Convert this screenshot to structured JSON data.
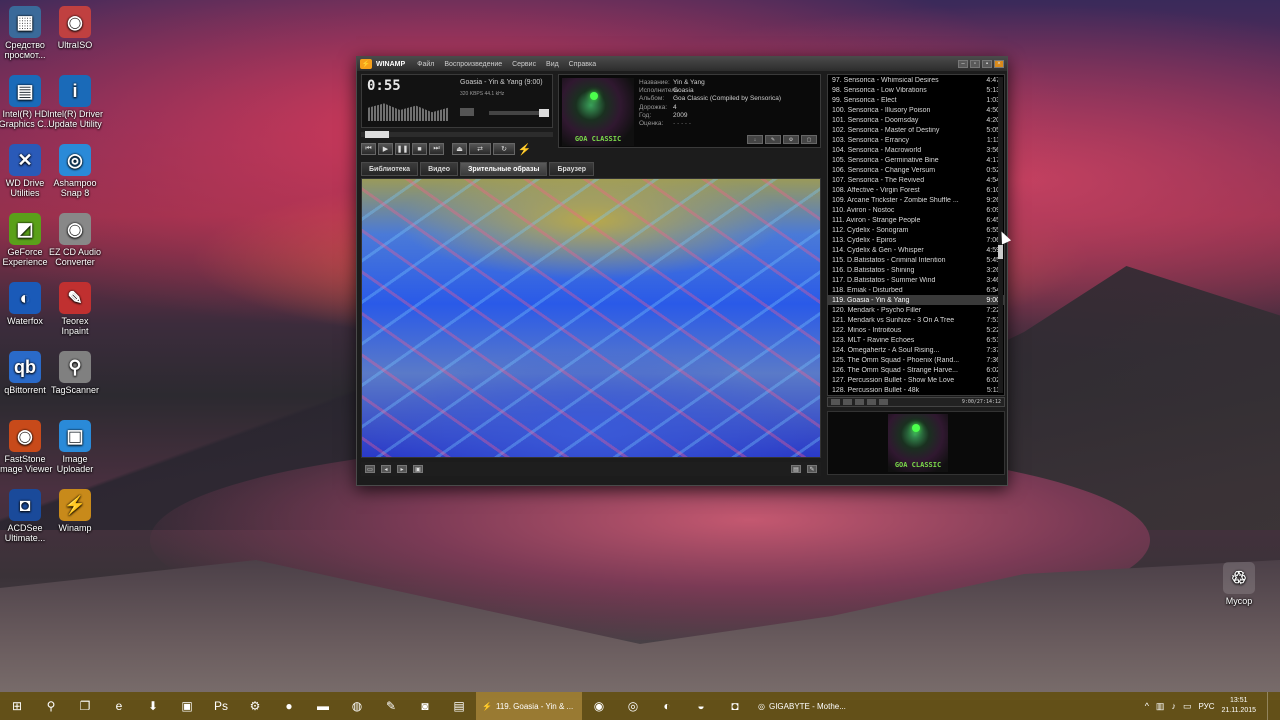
{
  "desktop": {
    "icons_left": [
      {
        "label": "Средство\nпросмот...",
        "icon": "image-viewer-icon",
        "glyph": "▦",
        "color": "#3a6a9a"
      },
      {
        "label": "UltraISO",
        "icon": "disc-icon",
        "glyph": "◉",
        "color": "#c04040"
      },
      {
        "label": "Intel(R) HD\nGraphics C...",
        "icon": "intel-graphics-icon",
        "glyph": "▤",
        "color": "#1a6ab8"
      },
      {
        "label": "Intel(R) Driver\nUpdate Utility",
        "icon": "intel-driver-icon",
        "glyph": "i",
        "color": "#1a6ab8"
      },
      {
        "label": "WD Drive\nUtilities",
        "icon": "wrench-icon",
        "glyph": "✕",
        "color": "#2a5ab8"
      },
      {
        "label": "Ashampoo\nSnap 8",
        "icon": "camera-shutter-icon",
        "glyph": "◎",
        "color": "#2a8ad8"
      },
      {
        "label": "GeForce\nExperience",
        "icon": "nvidia-icon",
        "glyph": "◩",
        "color": "#5aa01a"
      },
      {
        "label": "EZ CD Audio\nConverter",
        "icon": "cd-audio-icon",
        "glyph": "◉",
        "color": "#888888"
      },
      {
        "label": "Waterfox",
        "icon": "waterfox-icon",
        "glyph": "◐",
        "color": "#1a5ab8"
      },
      {
        "label": "Teorex\nInpaint",
        "icon": "eraser-icon",
        "glyph": "✎",
        "color": "#c03030"
      },
      {
        "label": "qBittorrent",
        "icon": "qbittorrent-icon",
        "glyph": "qb",
        "color": "#2a6ac8"
      },
      {
        "label": "TagScanner",
        "icon": "magnifier-icon",
        "glyph": "⚲",
        "color": "#808080"
      },
      {
        "label": "FastStone\nImage Viewer",
        "icon": "eye-icon",
        "glyph": "◉",
        "color": "#c84a1a"
      },
      {
        "label": "Image\nUploader",
        "icon": "image-uploader-icon",
        "glyph": "▣",
        "color": "#2a8ad8"
      },
      {
        "label": "ACDSee\nUltimate...",
        "icon": "acdsee-icon",
        "glyph": "◘",
        "color": "#1a4a9a"
      },
      {
        "label": "Winamp",
        "icon": "winamp-icon",
        "glyph": "⚡",
        "color": "#c88a1a"
      }
    ],
    "recycle_bin": {
      "label": "Мусор",
      "icon": "recycle-bin-icon",
      "glyph": "♲"
    }
  },
  "winamp": {
    "title": "WINAMP",
    "menu": [
      "Файл",
      "Воспроизведение",
      "Сервис",
      "Вид",
      "Справка"
    ],
    "time": "0:55",
    "now_playing": "Goasia - Yin & Yang (9:00)",
    "bitrate": "320 KBPS  44.1 kHz",
    "metadata": [
      {
        "label": "Название:",
        "value": "Yin & Yang"
      },
      {
        "label": "Исполнитель:",
        "value": "Goasia"
      },
      {
        "label": "Альбом:",
        "value": "Goa Classic (Compiled by Sensorica)"
      },
      {
        "label": "Дорожка:",
        "value": "4"
      },
      {
        "label": "Год:",
        "value": "2009"
      },
      {
        "label": "Оценка:",
        "value": "· · · · ·"
      }
    ],
    "album_art_text": "GOA CLASSIC",
    "tabs": [
      "Библиотека",
      "Видео",
      "Зрительные образы",
      "Браузер"
    ],
    "active_tab": "Зрительные образы",
    "playlist": [
      {
        "title": "97. Sensorica - Whimsical Desires",
        "dur": "4:47"
      },
      {
        "title": "98. Sensorica - Low Vibrations",
        "dur": "5:13"
      },
      {
        "title": "99. Sensorica - Elect",
        "dur": "1:03"
      },
      {
        "title": "100. Sensorica - Illusory Poison",
        "dur": "4:50"
      },
      {
        "title": "101. Sensorica - Doomsday",
        "dur": "4:20"
      },
      {
        "title": "102. Sensorica - Master of Destiny",
        "dur": "5:05"
      },
      {
        "title": "103. Sensorica - Errancy",
        "dur": "1:11"
      },
      {
        "title": "104. Sensorica - Macroworld",
        "dur": "3:56"
      },
      {
        "title": "105. Sensorica - Germinative Bine",
        "dur": "4:17"
      },
      {
        "title": "106. Sensorica - Change Versum",
        "dur": "0:52"
      },
      {
        "title": "107. Sensorica - The Revived",
        "dur": "4:54"
      },
      {
        "title": "108. Affective - Virgin Forest",
        "dur": "6:10"
      },
      {
        "title": "109. Arcane Trickster - Zombie Shuffle ...",
        "dur": "9:26"
      },
      {
        "title": "110. Aviron - Nostoc",
        "dur": "6:09"
      },
      {
        "title": "111. Aviron - Strange People",
        "dur": "6:45"
      },
      {
        "title": "112. Cydelix - Sonogram",
        "dur": "6:55"
      },
      {
        "title": "113. Cydelix - Epiros",
        "dur": "7:06"
      },
      {
        "title": "114. Cydelix & Gen - Whisper",
        "dur": "4:59"
      },
      {
        "title": "115. D.Batistatos - Criminal Intention",
        "dur": "5:45"
      },
      {
        "title": "116. D.Batistatos - Shining",
        "dur": "3:26"
      },
      {
        "title": "117. D.Batistatos - Summer Wind",
        "dur": "3:46"
      },
      {
        "title": "118. Emiak - Disturbed",
        "dur": "6:54"
      },
      {
        "title": "119. Goasia - Yin & Yang",
        "dur": "9:00"
      },
      {
        "title": "120. Mendark - Psycho Filler",
        "dur": "7:22"
      },
      {
        "title": "121. Mendark vs Sunhize - 3 On A Tree",
        "dur": "7:51"
      },
      {
        "title": "122. Minos - Introitous",
        "dur": "5:22"
      },
      {
        "title": "123. MLT - Ravine Echoes",
        "dur": "6:51"
      },
      {
        "title": "124. Omegahertz - A Soul Rising...",
        "dur": "7:37"
      },
      {
        "title": "125. The Omm Squad - Phoenix (Rand...",
        "dur": "7:36"
      },
      {
        "title": "126. The Omm Squad - Strange Harve...",
        "dur": "6:02"
      },
      {
        "title": "127. Percussion Bullet - Show Me Love",
        "dur": "6:02"
      },
      {
        "title": "128. Percussion Bullet - 48k",
        "dur": "5:11"
      }
    ],
    "selected_track_index": 22,
    "playlist_time": "9:00/27:14:12"
  },
  "taskbar": {
    "active_task": "119. Goasia - Yin & ...",
    "second_task": "GIGABYTE - Mothe...",
    "language": "РУС",
    "time": "13:51",
    "date": "21.11.2015"
  }
}
